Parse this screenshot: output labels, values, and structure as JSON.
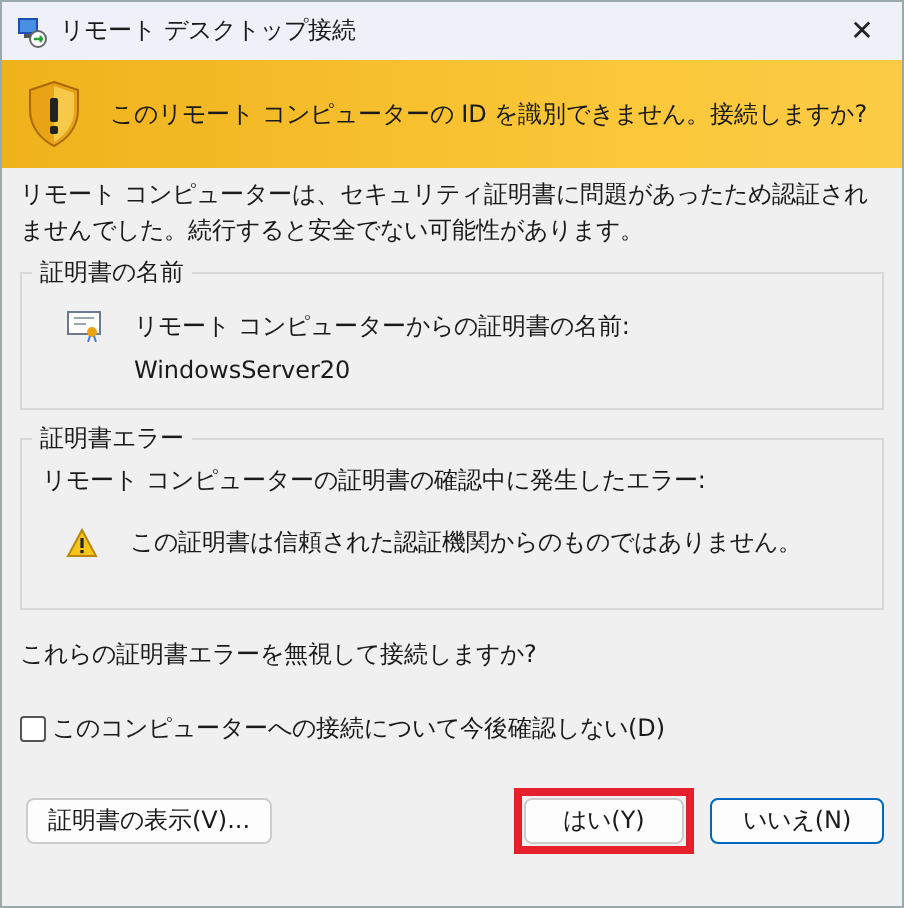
{
  "window": {
    "title": "リモート デスクトップ接続",
    "close": "✕"
  },
  "banner": {
    "text": "このリモート コンピューターの ID を識別できません。接続しますか?"
  },
  "description": "リモート コンピューターは、セキュリティ証明書に問題があったため認証されませんでした。続行すると安全でない可能性があります。",
  "groups": [
    {
      "title": "証明書の名前",
      "items": [
        {
          "kind": "certificate",
          "lines": [
            "リモート コンピューターからの証明書の名前:",
            "WindowsServer20"
          ]
        }
      ]
    },
    {
      "title": "証明書エラー",
      "intro": "リモート コンピューターの証明書の確認中に発生したエラー:",
      "items": [
        {
          "kind": "warning",
          "lines": [
            "この証明書は信頼された認証機関からのものではありません。"
          ]
        }
      ]
    }
  ],
  "question": "これらの証明書エラーを無視して接続しますか?",
  "checkbox": {
    "label": "このコンピューターへの接続について今後確認しない(D)",
    "checked": false
  },
  "buttons": [
    {
      "label": "証明書の表示(V)...",
      "kind": "left",
      "highlighted": false,
      "default": false
    },
    {
      "label": "はい(Y)",
      "kind": "right",
      "highlighted": true,
      "default": false
    },
    {
      "label": "いいえ(N)",
      "kind": "right",
      "highlighted": false,
      "default": true
    }
  ]
}
